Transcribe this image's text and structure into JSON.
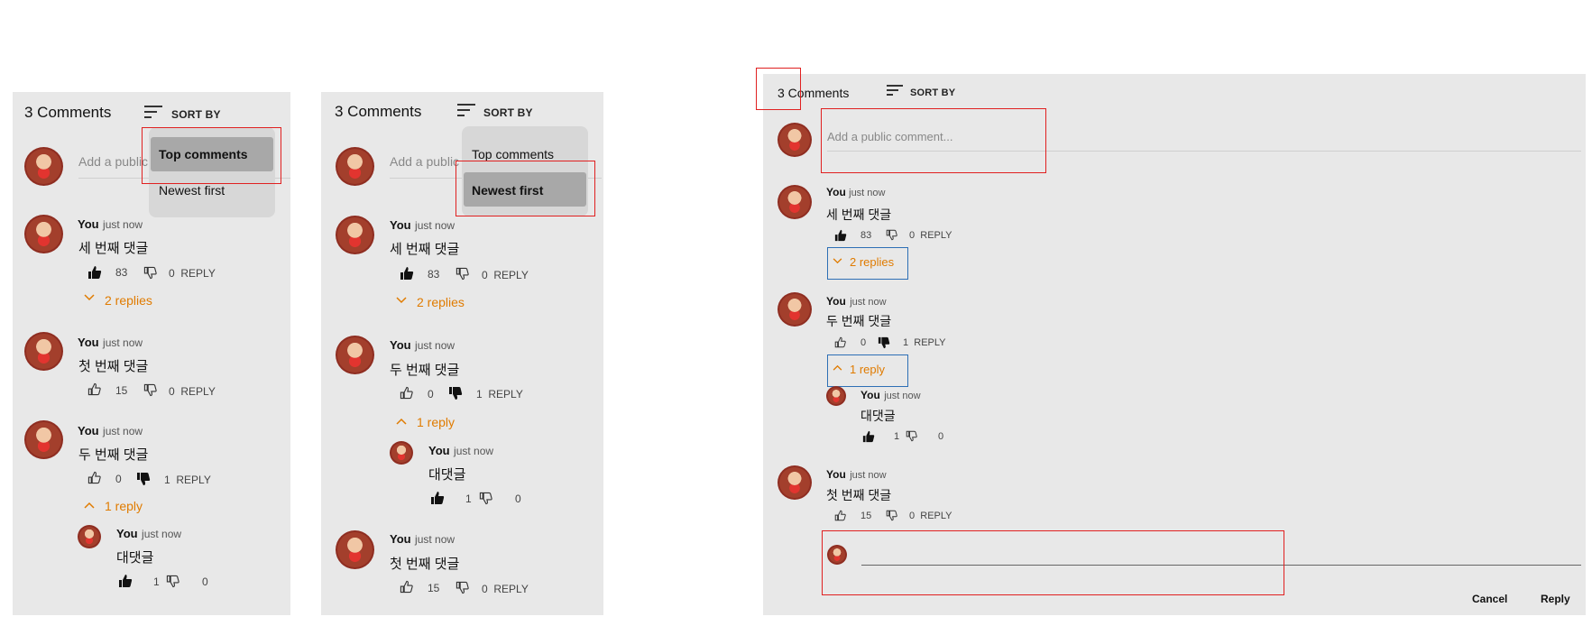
{
  "header": {
    "count": "3 Comments",
    "sort_label": "SORT BY"
  },
  "composer": {
    "placeholder_short": "Add a public",
    "placeholder_full": "Add a public comment..."
  },
  "sort_menu": {
    "top": "Top comments",
    "newest": "Newest first"
  },
  "common": {
    "author": "You",
    "time": "just now",
    "reply": "REPLY"
  },
  "comments": {
    "third": {
      "text": "세 번째 댓글",
      "likes": "83",
      "dislikes": "0",
      "replies_toggle": "2 replies"
    },
    "second": {
      "text": "두 번째 댓글",
      "likes": "0",
      "dislikes": "1",
      "replies_toggle": "1 reply"
    },
    "first": {
      "text": "첫 번째 댓글",
      "likes": "15",
      "dislikes": "0"
    },
    "nested": {
      "text": "대댓글",
      "likes": "1",
      "dislikes": "0"
    }
  },
  "reply_box": {
    "cancel": "Cancel",
    "reply": "Reply"
  },
  "colors": {
    "panel": "#e8e8e8",
    "accent": "#e07b00",
    "highlight_red": "#e02020",
    "highlight_blue": "#2d6fb5"
  }
}
